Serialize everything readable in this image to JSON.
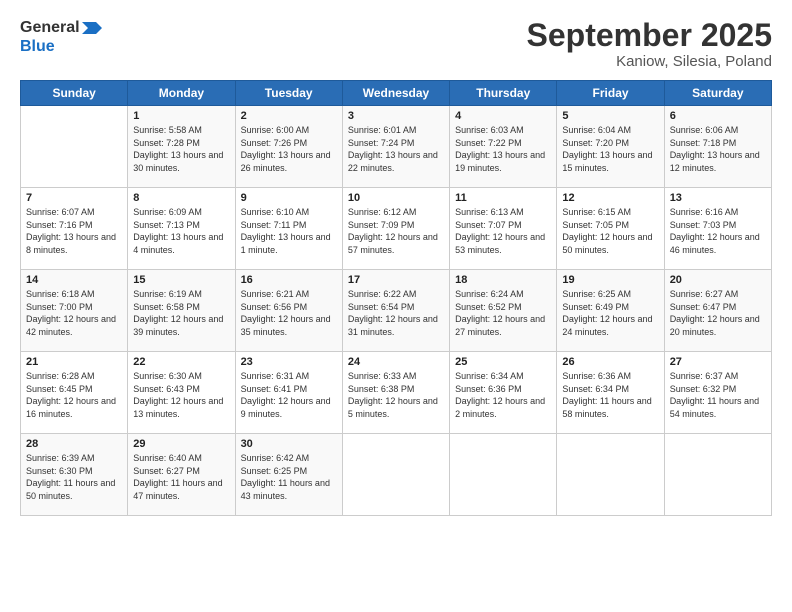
{
  "logo": {
    "line1": "General",
    "line2": "Blue"
  },
  "title": "September 2025",
  "subtitle": "Kaniow, Silesia, Poland",
  "days_header": [
    "Sunday",
    "Monday",
    "Tuesday",
    "Wednesday",
    "Thursday",
    "Friday",
    "Saturday"
  ],
  "weeks": [
    [
      {
        "num": "",
        "sunrise": "",
        "sunset": "",
        "daylight": ""
      },
      {
        "num": "1",
        "sunrise": "Sunrise: 5:58 AM",
        "sunset": "Sunset: 7:28 PM",
        "daylight": "Daylight: 13 hours and 30 minutes."
      },
      {
        "num": "2",
        "sunrise": "Sunrise: 6:00 AM",
        "sunset": "Sunset: 7:26 PM",
        "daylight": "Daylight: 13 hours and 26 minutes."
      },
      {
        "num": "3",
        "sunrise": "Sunrise: 6:01 AM",
        "sunset": "Sunset: 7:24 PM",
        "daylight": "Daylight: 13 hours and 22 minutes."
      },
      {
        "num": "4",
        "sunrise": "Sunrise: 6:03 AM",
        "sunset": "Sunset: 7:22 PM",
        "daylight": "Daylight: 13 hours and 19 minutes."
      },
      {
        "num": "5",
        "sunrise": "Sunrise: 6:04 AM",
        "sunset": "Sunset: 7:20 PM",
        "daylight": "Daylight: 13 hours and 15 minutes."
      },
      {
        "num": "6",
        "sunrise": "Sunrise: 6:06 AM",
        "sunset": "Sunset: 7:18 PM",
        "daylight": "Daylight: 13 hours and 12 minutes."
      }
    ],
    [
      {
        "num": "7",
        "sunrise": "Sunrise: 6:07 AM",
        "sunset": "Sunset: 7:16 PM",
        "daylight": "Daylight: 13 hours and 8 minutes."
      },
      {
        "num": "8",
        "sunrise": "Sunrise: 6:09 AM",
        "sunset": "Sunset: 7:13 PM",
        "daylight": "Daylight: 13 hours and 4 minutes."
      },
      {
        "num": "9",
        "sunrise": "Sunrise: 6:10 AM",
        "sunset": "Sunset: 7:11 PM",
        "daylight": "Daylight: 13 hours and 1 minute."
      },
      {
        "num": "10",
        "sunrise": "Sunrise: 6:12 AM",
        "sunset": "Sunset: 7:09 PM",
        "daylight": "Daylight: 12 hours and 57 minutes."
      },
      {
        "num": "11",
        "sunrise": "Sunrise: 6:13 AM",
        "sunset": "Sunset: 7:07 PM",
        "daylight": "Daylight: 12 hours and 53 minutes."
      },
      {
        "num": "12",
        "sunrise": "Sunrise: 6:15 AM",
        "sunset": "Sunset: 7:05 PM",
        "daylight": "Daylight: 12 hours and 50 minutes."
      },
      {
        "num": "13",
        "sunrise": "Sunrise: 6:16 AM",
        "sunset": "Sunset: 7:03 PM",
        "daylight": "Daylight: 12 hours and 46 minutes."
      }
    ],
    [
      {
        "num": "14",
        "sunrise": "Sunrise: 6:18 AM",
        "sunset": "Sunset: 7:00 PM",
        "daylight": "Daylight: 12 hours and 42 minutes."
      },
      {
        "num": "15",
        "sunrise": "Sunrise: 6:19 AM",
        "sunset": "Sunset: 6:58 PM",
        "daylight": "Daylight: 12 hours and 39 minutes."
      },
      {
        "num": "16",
        "sunrise": "Sunrise: 6:21 AM",
        "sunset": "Sunset: 6:56 PM",
        "daylight": "Daylight: 12 hours and 35 minutes."
      },
      {
        "num": "17",
        "sunrise": "Sunrise: 6:22 AM",
        "sunset": "Sunset: 6:54 PM",
        "daylight": "Daylight: 12 hours and 31 minutes."
      },
      {
        "num": "18",
        "sunrise": "Sunrise: 6:24 AM",
        "sunset": "Sunset: 6:52 PM",
        "daylight": "Daylight: 12 hours and 27 minutes."
      },
      {
        "num": "19",
        "sunrise": "Sunrise: 6:25 AM",
        "sunset": "Sunset: 6:49 PM",
        "daylight": "Daylight: 12 hours and 24 minutes."
      },
      {
        "num": "20",
        "sunrise": "Sunrise: 6:27 AM",
        "sunset": "Sunset: 6:47 PM",
        "daylight": "Daylight: 12 hours and 20 minutes."
      }
    ],
    [
      {
        "num": "21",
        "sunrise": "Sunrise: 6:28 AM",
        "sunset": "Sunset: 6:45 PM",
        "daylight": "Daylight: 12 hours and 16 minutes."
      },
      {
        "num": "22",
        "sunrise": "Sunrise: 6:30 AM",
        "sunset": "Sunset: 6:43 PM",
        "daylight": "Daylight: 12 hours and 13 minutes."
      },
      {
        "num": "23",
        "sunrise": "Sunrise: 6:31 AM",
        "sunset": "Sunset: 6:41 PM",
        "daylight": "Daylight: 12 hours and 9 minutes."
      },
      {
        "num": "24",
        "sunrise": "Sunrise: 6:33 AM",
        "sunset": "Sunset: 6:38 PM",
        "daylight": "Daylight: 12 hours and 5 minutes."
      },
      {
        "num": "25",
        "sunrise": "Sunrise: 6:34 AM",
        "sunset": "Sunset: 6:36 PM",
        "daylight": "Daylight: 12 hours and 2 minutes."
      },
      {
        "num": "26",
        "sunrise": "Sunrise: 6:36 AM",
        "sunset": "Sunset: 6:34 PM",
        "daylight": "Daylight: 11 hours and 58 minutes."
      },
      {
        "num": "27",
        "sunrise": "Sunrise: 6:37 AM",
        "sunset": "Sunset: 6:32 PM",
        "daylight": "Daylight: 11 hours and 54 minutes."
      }
    ],
    [
      {
        "num": "28",
        "sunrise": "Sunrise: 6:39 AM",
        "sunset": "Sunset: 6:30 PM",
        "daylight": "Daylight: 11 hours and 50 minutes."
      },
      {
        "num": "29",
        "sunrise": "Sunrise: 6:40 AM",
        "sunset": "Sunset: 6:27 PM",
        "daylight": "Daylight: 11 hours and 47 minutes."
      },
      {
        "num": "30",
        "sunrise": "Sunrise: 6:42 AM",
        "sunset": "Sunset: 6:25 PM",
        "daylight": "Daylight: 11 hours and 43 minutes."
      },
      {
        "num": "",
        "sunrise": "",
        "sunset": "",
        "daylight": ""
      },
      {
        "num": "",
        "sunrise": "",
        "sunset": "",
        "daylight": ""
      },
      {
        "num": "",
        "sunrise": "",
        "sunset": "",
        "daylight": ""
      },
      {
        "num": "",
        "sunrise": "",
        "sunset": "",
        "daylight": ""
      }
    ]
  ]
}
